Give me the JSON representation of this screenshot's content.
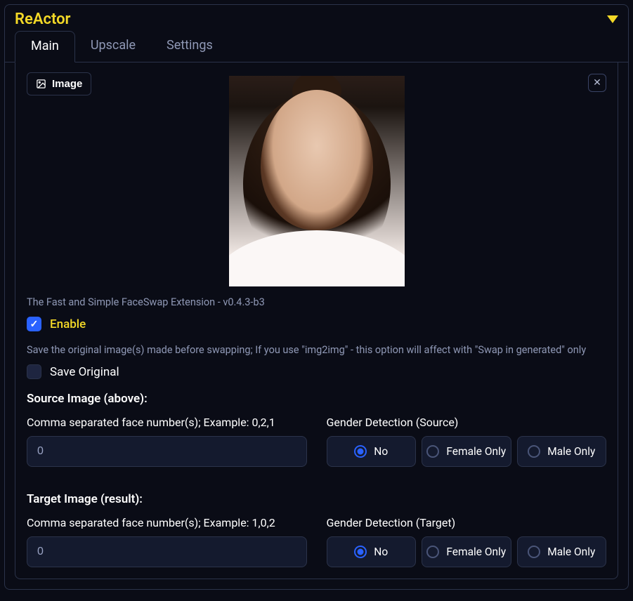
{
  "panel": {
    "title": "ReActor"
  },
  "tabs": [
    {
      "label": "Main",
      "active": true
    },
    {
      "label": "Upscale",
      "active": false
    },
    {
      "label": "Settings",
      "active": false
    }
  ],
  "image_button_label": "Image",
  "close_glyph": "✕",
  "description": "The Fast and Simple FaceSwap Extension - v0.4.3-b3",
  "enable": {
    "label": "Enable",
    "checked": true
  },
  "save_original": {
    "hint": "Save the original image(s) made before swapping; If you use \"img2img\" - this option will affect with \"Swap in generated\" only",
    "label": "Save Original",
    "checked": false
  },
  "source": {
    "section": "Source Image (above):",
    "face_numbers_label": "Comma separated face number(s); Example: 0,2,1",
    "face_numbers_value": "0",
    "gender_label": "Gender Detection (Source)",
    "gender_options": [
      "No",
      "Female Only",
      "Male Only"
    ],
    "gender_selected": "No"
  },
  "target": {
    "section": "Target Image (result):",
    "face_numbers_label": "Comma separated face number(s); Example: 1,0,2",
    "face_numbers_value": "0",
    "gender_label": "Gender Detection (Target)",
    "gender_options": [
      "No",
      "Female Only",
      "Male Only"
    ],
    "gender_selected": "No"
  },
  "colors": {
    "accent": "#f4d927",
    "primary": "#2a62ff",
    "border": "#2b334a",
    "bg": "#0a0c16"
  }
}
